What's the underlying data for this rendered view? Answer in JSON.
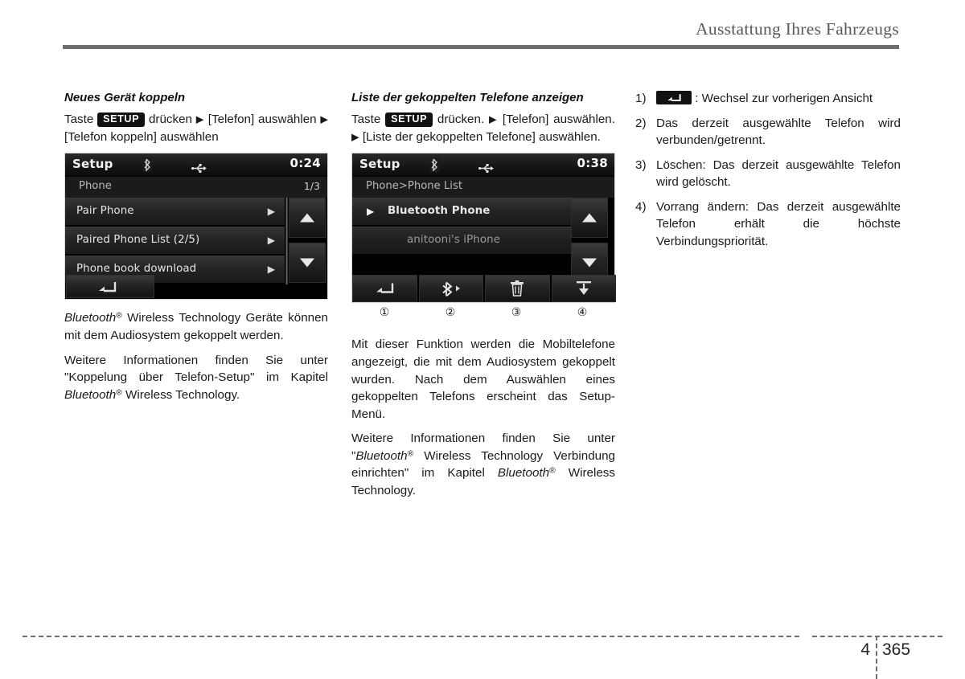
{
  "header": {
    "title": "Ausstattung Ihres Fahrzeugs"
  },
  "footer": {
    "chapter": "4",
    "page": "365"
  },
  "column_left": {
    "heading": "Neues Gerät koppeln",
    "instruction": {
      "pre": "Taste",
      "key": "SETUP",
      "mid": "drücken",
      "arrow": "▶",
      "target1": "[Telefon] auswählen",
      "arrow2": "▶",
      "target2": "[Telefon koppeln] auswählen"
    },
    "screenshot": {
      "status": {
        "title": "Setup",
        "bluetooth_icon": "bluetooth-icon",
        "usb_icon": "usb-icon",
        "clock": "0:24"
      },
      "breadcrumb": "Phone",
      "page_indicator": "1/3",
      "rows": [
        {
          "label": "Pair Phone",
          "arrow": "▶"
        },
        {
          "label": "Paired Phone List  (2/5)",
          "arrow": "▶"
        },
        {
          "label": "Phone book download",
          "arrow": "▶"
        }
      ],
      "scroll_up": "scroll-up-arrow",
      "scroll_down": "scroll-down-arrow",
      "back_button": "back-arrow-icon"
    },
    "paragraph_1": {
      "bt": "Bluetooth",
      "reg": "®",
      "rest": " Wireless Technology Geräte können mit dem Audiosystem gekoppelt werden."
    },
    "paragraph_2": {
      "pre": "Weitere Informationen finden Sie unter \"Koppelung über Telefon-Setup\" im Kapitel ",
      "bt": "Bluetooth",
      "reg": "®",
      "post": " Wireless Technology."
    }
  },
  "column_middle": {
    "heading": "Liste der gekoppelten Telefone anzeigen",
    "instruction": {
      "pre": "Taste",
      "key": "SETUP",
      "mid": "drücken.",
      "arrow": "▶",
      "target1": "[Telefon] auswählen.",
      "arrow2": "▶",
      "target2": "[Liste der gekoppelten Telefone] auswählen."
    },
    "screenshot": {
      "status": {
        "title": "Setup",
        "bluetooth_icon": "bluetooth-icon",
        "usb_icon": "usb-icon",
        "clock": "0:38"
      },
      "breadcrumb": "Phone>Phone List",
      "rows": [
        {
          "lead": "▶",
          "label": "Bluetooth Phone",
          "selected": true
        },
        {
          "lead": "",
          "label": "anitooni's iPhone",
          "selected": false
        }
      ],
      "scroll_up": "scroll-up-arrow",
      "scroll_down": "scroll-down-arrow",
      "toolbar": [
        {
          "icon": "back-arrow-icon",
          "callout": "①"
        },
        {
          "icon": "bluetooth-connect-icon",
          "callout": "②"
        },
        {
          "icon": "trash-delete-icon",
          "callout": "③"
        },
        {
          "icon": "set-priority-icon",
          "callout": "④"
        }
      ]
    },
    "paragraph_1": "Mit dieser Funktion werden die Mobiltelefone angezeigt, die mit dem Audiosystem gekoppelt wurden. Nach dem Auswählen eines gekoppelten Telefons erscheint das Setup-Menü.",
    "paragraph_2": {
      "pre": "Weitere Informationen finden Sie unter \"",
      "bt": "Bluetooth",
      "reg": "®",
      "mid": " Wireless Technology Verbindung einrichten\" im Kapitel ",
      "bt2": "Bluetooth",
      "reg2": "®",
      "post": " Wireless Technology."
    }
  },
  "column_right": {
    "items": [
      {
        "mark": "1)",
        "icon": "back-arrow-icon",
        "text": ": Wechsel zur vorherigen Ansicht"
      },
      {
        "mark": "2)",
        "text": "Das derzeit ausgewählte Telefon wird verbunden/getrennt."
      },
      {
        "mark": "3)",
        "text": "Löschen: Das derzeit ausgewählte Telefon wird gelöscht."
      },
      {
        "mark": "4)",
        "text": "Vorrang ändern: Das derzeit ausgewählte Telefon erhält die höchste Verbindungspriorität."
      }
    ]
  },
  "colors": {
    "header_rule": "#6d6e71",
    "screen_background": "#000000",
    "screen_text": "#e6e6e6",
    "dim_text": "#9b9b9b"
  }
}
